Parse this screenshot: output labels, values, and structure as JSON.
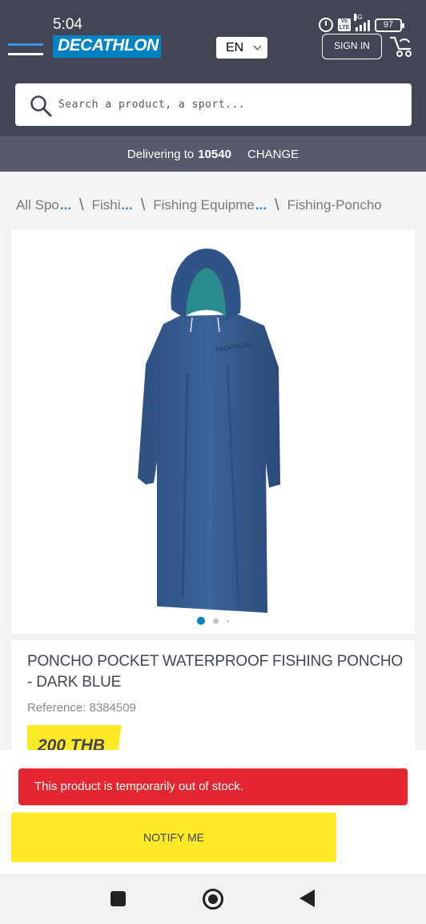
{
  "status_bar": {
    "time": "5:04",
    "network": "4G",
    "volte": "Vo LTE",
    "battery": "97"
  },
  "header": {
    "logo_text": "DECATHLON",
    "language": "EN",
    "signin_label": "SIGN IN"
  },
  "search": {
    "placeholder": "Search a product, a sport..."
  },
  "delivery": {
    "prefix": "Delivering to",
    "zip": "10540",
    "change_label": "CHANGE"
  },
  "breadcrumb": [
    "All Spo",
    "Fishi",
    "Fishing Equipme",
    "Fishing-Poncho"
  ],
  "product": {
    "title": "PONCHO POCKET WATERPROOF FISHING PONCHO - DARK BLUE",
    "reference": "Reference: 8384509",
    "price": "200 THB",
    "image_count": 3,
    "active_image_index": 0
  },
  "stock": {
    "message": "This product is temporarily out of stock.",
    "notify_label": "NOTIFY ME"
  },
  "colors": {
    "header_bg": "#424553",
    "brand_blue": "#0082c3",
    "price_yellow": "#ffea28",
    "alert_red": "#e3262f"
  }
}
